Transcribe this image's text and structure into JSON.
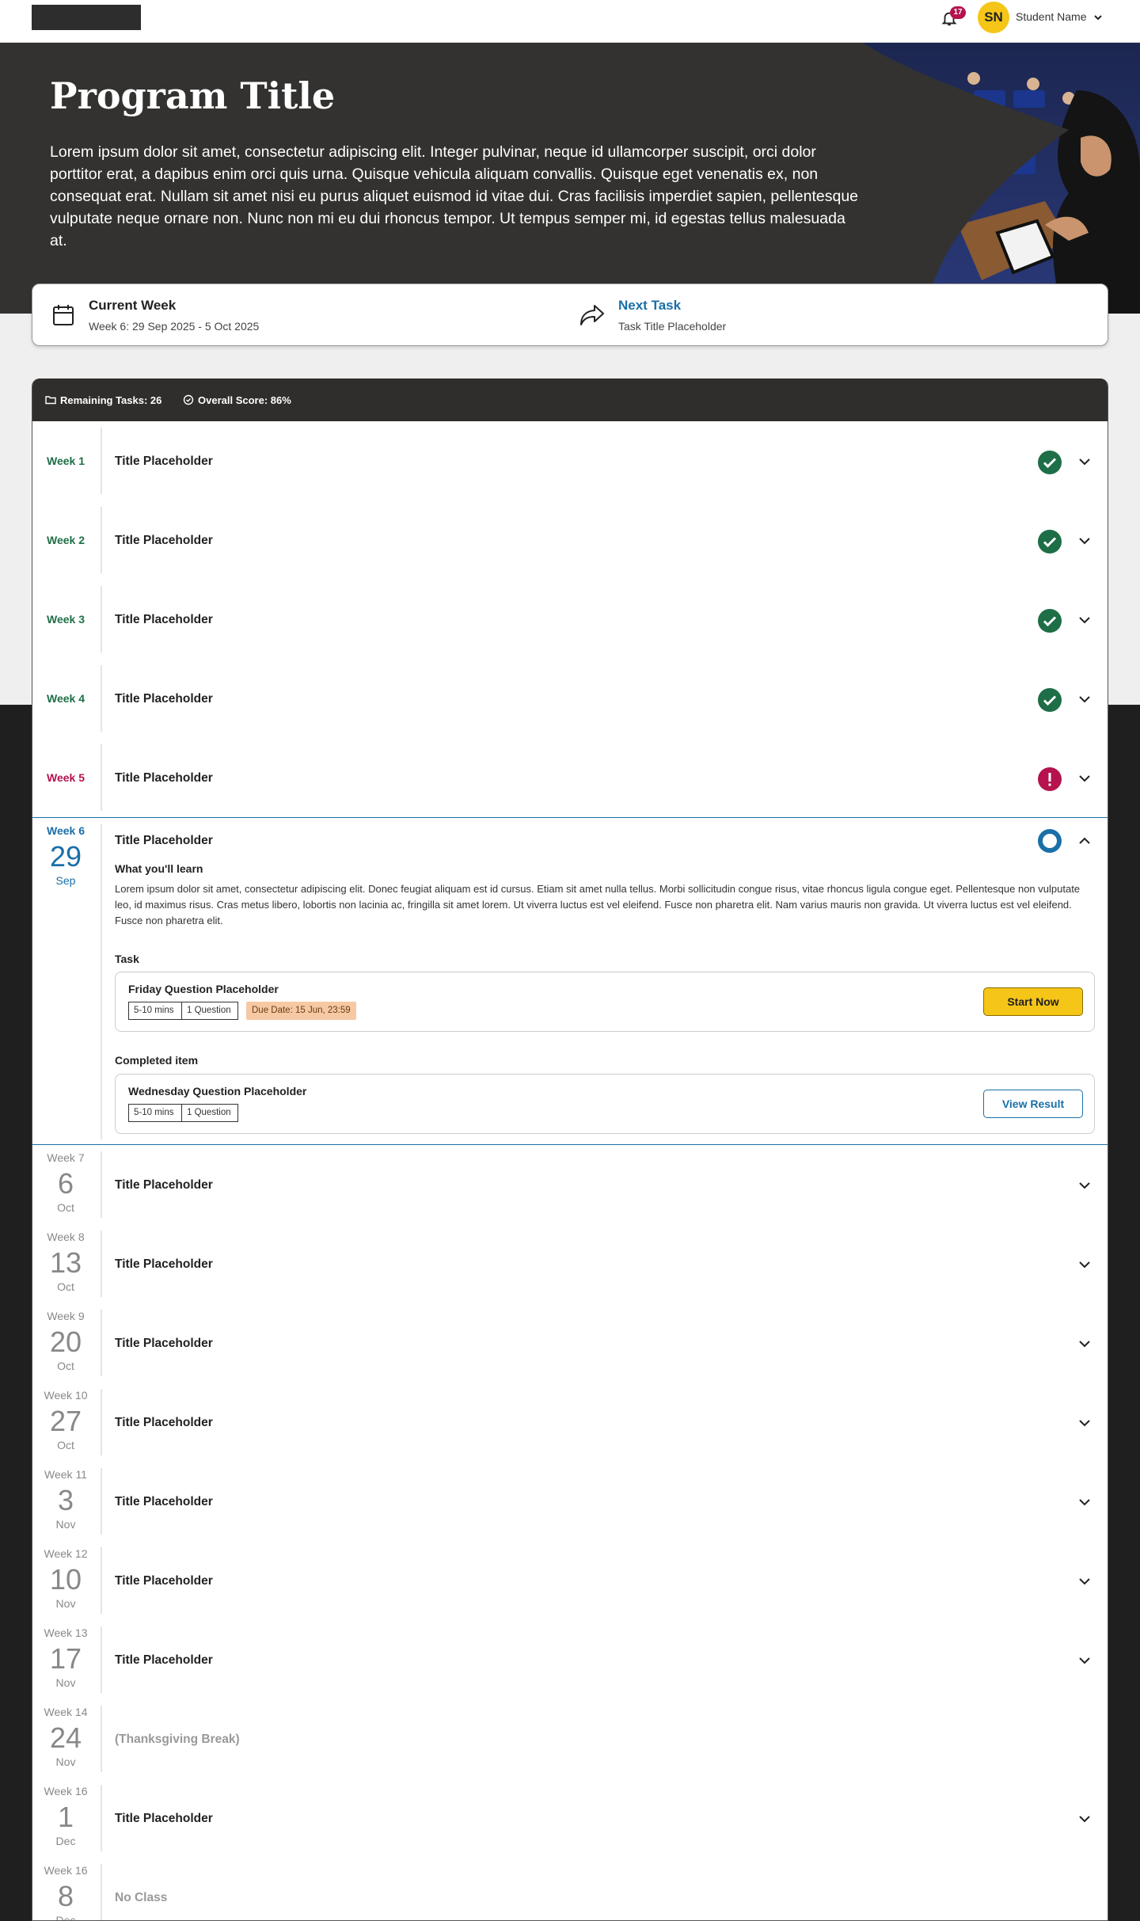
{
  "header": {
    "notifications_count": "17",
    "avatar_initials": "SN",
    "user_name": "Student Name"
  },
  "hero": {
    "title": "Program Title",
    "description": "Lorem ipsum dolor sit amet, consectetur adipiscing elit. Integer pulvinar, neque id ullamcorper suscipit, orci dolor porttitor erat, a dapibus enim orci quis urna. Quisque vehicula aliquam convallis. Quisque eget venenatis ex, non consequat erat. Nullam sit amet nisi eu purus aliquet euismod id vitae dui. Cras facilisis imperdiet sapien, pellentesque vulputate neque ornare non. Nunc non mi eu dui rhoncus tempor. Ut tempus semper mi, id egestas tellus malesuada at."
  },
  "info": {
    "current_week_label": "Current Week",
    "current_week_value": "Week 6: 29 Sep 2025 - 5 Oct 2025",
    "next_task_label": "Next Task",
    "next_task_value": "Task Title Placeholder"
  },
  "summary": {
    "remaining_tasks": "Remaining Tasks: 26",
    "overall_score": "Overall Score: 86%"
  },
  "colors": {
    "complete": "#1e6e47",
    "overdue": "#b5124e",
    "current": "#1a6fa8",
    "accent_yellow": "#f5c518"
  },
  "weeks_past": [
    {
      "label": "Week 1",
      "title": "Title Placeholder",
      "status": "complete"
    },
    {
      "label": "Week 2",
      "title": "Title Placeholder",
      "status": "complete"
    },
    {
      "label": "Week 3",
      "title": "Title Placeholder",
      "status": "complete"
    },
    {
      "label": "Week 4",
      "title": "Title Placeholder",
      "status": "complete"
    },
    {
      "label": "Week 5",
      "title": "Title Placeholder",
      "status": "overdue"
    }
  ],
  "current_week": {
    "label": "Week 6",
    "day": "29",
    "month": "Sep",
    "title": "Title Placeholder",
    "learn_heading": "What you'll learn",
    "learn_body": "Lorem ipsum dolor sit amet, consectetur adipiscing elit. Donec feugiat aliquam est id cursus. Etiam sit amet nulla tellus. Morbi sollicitudin congue risus, vitae rhoncus ligula congue eget. Pellentesque non vulputate leo, id maximus risus. Cras metus libero, lobortis non lacinia ac, fringilla sit amet lorem. Ut viverra luctus est vel eleifend. Fusce non pharetra elit. Nam varius mauris non gravida. Ut viverra luctus est vel eleifend. Fusce non pharetra elit.",
    "task_heading": "Task",
    "task": {
      "title": "Friday Question Placeholder",
      "duration": "5-10 mins",
      "questions": "1 Question",
      "due": "Due Date: 15 Jun, 23:59",
      "button": "Start Now"
    },
    "completed_heading": "Completed item",
    "completed": {
      "title": "Wednesday Question Placeholder",
      "duration": "5-10 mins",
      "questions": "1 Question",
      "button": "View Result"
    }
  },
  "weeks_upcoming": [
    {
      "label": "Week 7",
      "day": "6",
      "month": "Oct",
      "title": "Title Placeholder"
    },
    {
      "label": "Week 8",
      "day": "13",
      "month": "Oct",
      "title": "Title Placeholder"
    },
    {
      "label": "Week 9",
      "day": "20",
      "month": "Oct",
      "title": "Title Placeholder"
    },
    {
      "label": "Week 10",
      "day": "27",
      "month": "Oct",
      "title": "Title Placeholder"
    },
    {
      "label": "Week 11",
      "day": "3",
      "month": "Nov",
      "title": "Title Placeholder"
    },
    {
      "label": "Week 12",
      "day": "10",
      "month": "Nov",
      "title": "Title Placeholder"
    },
    {
      "label": "Week 13",
      "day": "17",
      "month": "Nov",
      "title": "Title Placeholder"
    },
    {
      "label": "Week 14",
      "day": "24",
      "month": "Nov",
      "title": "(Thanksgiving Break)"
    },
    {
      "label": "Week 16",
      "day": "1",
      "month": "Dec",
      "title": "Title Placeholder"
    },
    {
      "label": "Week 16",
      "day": "8",
      "month": "Dec",
      "title": "No Class"
    }
  ]
}
